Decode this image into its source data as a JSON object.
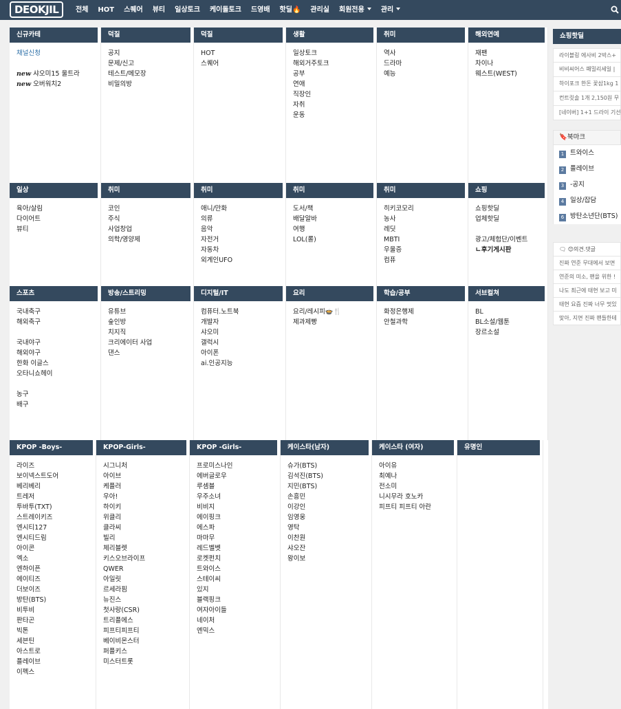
{
  "nav": {
    "logo": "DEOKJIL",
    "items": [
      "전체",
      "HOT",
      "스퀘어",
      "뷰티",
      "일상토크",
      "케이돌토크",
      "드영배",
      "핫딜🔥",
      "관리실",
      "회원전용",
      "관리"
    ],
    "search_icon": "search-icon"
  },
  "rows": [
    [
      {
        "title": "신규카테",
        "links": [
          {
            "text": "채널신청",
            "style": "blue"
          },
          {
            "gap": true
          },
          {
            "text": "샤오미15 울트라",
            "new": "new"
          },
          {
            "text": "오버워치2",
            "new": "new"
          }
        ]
      },
      {
        "title": "덕질",
        "links": [
          {
            "text": "공지"
          },
          {
            "text": "문제/신고"
          },
          {
            "text": "테스트/메모장"
          },
          {
            "text": "비밀의방"
          }
        ]
      },
      {
        "title": "덕질",
        "links": [
          {
            "text": "HOT"
          },
          {
            "text": "스퀘어"
          }
        ]
      },
      {
        "title": "생활",
        "links": [
          {
            "text": "일상토크"
          },
          {
            "text": "해외거주토크"
          },
          {
            "text": "공부"
          },
          {
            "text": "연애"
          },
          {
            "text": "직장인"
          },
          {
            "text": "자취"
          },
          {
            "text": "운동"
          }
        ]
      },
      {
        "title": "취미",
        "links": [
          {
            "text": "역사"
          },
          {
            "text": "드라마"
          },
          {
            "text": "예능"
          }
        ]
      },
      {
        "title": "해외연예",
        "links": [
          {
            "text": "재팬"
          },
          {
            "text": "차이나"
          },
          {
            "text": "웨스트(WEST)"
          }
        ]
      }
    ],
    [
      {
        "title": "일상",
        "links": [
          {
            "text": "육아/살림"
          },
          {
            "text": "다이어트"
          },
          {
            "text": "뷰티"
          }
        ]
      },
      {
        "title": "취미",
        "links": [
          {
            "text": "코인"
          },
          {
            "text": "주식"
          },
          {
            "text": "사업창업"
          },
          {
            "text": "의학/영양제"
          }
        ]
      },
      {
        "title": "취미",
        "links": [
          {
            "text": "애니/만화"
          },
          {
            "text": "의류"
          },
          {
            "text": "음악"
          },
          {
            "text": "자전거"
          },
          {
            "text": "자동차"
          },
          {
            "text": "외계인UFO"
          }
        ]
      },
      {
        "title": "취미",
        "links": [
          {
            "text": "도서/책"
          },
          {
            "text": "배달알바"
          },
          {
            "text": "여행"
          },
          {
            "text": "LOL(롤)"
          }
        ]
      },
      {
        "title": "취미",
        "links": [
          {
            "text": "히키코모리"
          },
          {
            "text": "농사"
          },
          {
            "text": "레딧"
          },
          {
            "text": "MBTI"
          },
          {
            "text": "우울증"
          },
          {
            "text": "컴퓨"
          }
        ]
      },
      {
        "title": "쇼핑",
        "links": [
          {
            "text": "쇼핑핫딜"
          },
          {
            "text": "업체핫딜"
          },
          {
            "gap": true
          },
          {
            "text": "광고/체험단/이벤트"
          },
          {
            "text": "ㄴ후기게시판",
            "style": "bold"
          }
        ]
      }
    ],
    [
      {
        "title": "스포츠",
        "links": [
          {
            "text": "국내축구"
          },
          {
            "text": "해외축구"
          },
          {
            "gap": true
          },
          {
            "text": "국내야구"
          },
          {
            "text": "해외야구"
          },
          {
            "text": "한화 이글스"
          },
          {
            "text": "오타니쇼헤이"
          },
          {
            "gap": true
          },
          {
            "text": "농구"
          },
          {
            "text": "배구"
          }
        ]
      },
      {
        "title": "방송/스트리밍",
        "links": [
          {
            "text": "유튜브"
          },
          {
            "text": "숲인방"
          },
          {
            "text": "치지직"
          },
          {
            "text": "크리에이터 사업"
          },
          {
            "text": "댄스"
          }
        ]
      },
      {
        "title": "디지털/IT",
        "links": [
          {
            "text": "컴퓨터.노트북"
          },
          {
            "text": "개발자"
          },
          {
            "text": "샤오미"
          },
          {
            "text": "갤럭시"
          },
          {
            "text": "아이폰"
          },
          {
            "text": "ai.인공지능"
          }
        ]
      },
      {
        "title": "요리",
        "links": [
          {
            "text": "요리/레시피🍲🍴"
          },
          {
            "text": "제과제빵"
          }
        ]
      },
      {
        "title": "학습/공부",
        "links": [
          {
            "text": "화정은행제"
          },
          {
            "text": "안철과학"
          }
        ]
      },
      {
        "title": "서브컬쳐",
        "links": [
          {
            "text": "BL"
          },
          {
            "text": "BL소설/웹툰"
          },
          {
            "text": "장르소설"
          }
        ]
      }
    ],
    [
      {
        "title": "KPOP -Boys-",
        "links": [
          {
            "text": "라이즈"
          },
          {
            "text": "보이넥스트도어"
          },
          {
            "text": "베리베리"
          },
          {
            "text": "트레저"
          },
          {
            "text": "투바투(TXT)"
          },
          {
            "text": "스트레이키즈"
          },
          {
            "text": "엔시티127"
          },
          {
            "text": "엔시티드림"
          },
          {
            "text": "아이콘"
          },
          {
            "text": "엑소"
          },
          {
            "text": "엔하이픈"
          },
          {
            "text": "에이티즈"
          },
          {
            "text": "더보이즈"
          },
          {
            "text": "방탄(BTS)"
          },
          {
            "text": "비투비"
          },
          {
            "text": "판타곤"
          },
          {
            "text": "빅톤"
          },
          {
            "text": "세븐틴"
          },
          {
            "text": "아스트로"
          },
          {
            "text": "플레이브"
          },
          {
            "text": "이펙스"
          }
        ]
      },
      {
        "title": "KPOP-Girls-",
        "links": [
          {
            "text": "시그니처"
          },
          {
            "text": "아이브"
          },
          {
            "text": "케플러"
          },
          {
            "text": "우아!"
          },
          {
            "text": "하이키"
          },
          {
            "text": "위클리"
          },
          {
            "text": "클라씨"
          },
          {
            "text": "빌리"
          },
          {
            "text": "체리블렛"
          },
          {
            "text": "키스오브라이프"
          },
          {
            "text": "QWER"
          },
          {
            "text": "아일릿"
          },
          {
            "text": "르세라핌"
          },
          {
            "text": "뉴진스"
          },
          {
            "text": "첫사랑(CSR)"
          },
          {
            "text": "트리플에스"
          },
          {
            "text": "피프티피프티"
          },
          {
            "text": "베이비몬스터"
          },
          {
            "text": "퍼플키스"
          },
          {
            "text": "미스터트롯"
          }
        ]
      },
      {
        "title": "KPOP -Girls-",
        "links": [
          {
            "text": "프로미스나인"
          },
          {
            "text": "에버글로우"
          },
          {
            "text": "루셈블"
          },
          {
            "text": "우주소녀"
          },
          {
            "text": "비비지"
          },
          {
            "text": "에이핑크"
          },
          {
            "text": "에스파"
          },
          {
            "text": "마마무"
          },
          {
            "text": "레드벨벳"
          },
          {
            "text": "로켓펀치"
          },
          {
            "text": "트와이스"
          },
          {
            "text": "스테이씨"
          },
          {
            "text": "있지"
          },
          {
            "text": "블랙핑크"
          },
          {
            "text": "여자아이들"
          },
          {
            "text": "네이처"
          },
          {
            "text": "엔믹스"
          }
        ]
      },
      {
        "title": "케이스타(남자)",
        "links": [
          {
            "text": "슈가(BTS)"
          },
          {
            "text": "김석진(BTS)"
          },
          {
            "text": "지민(BTS)"
          },
          {
            "text": "손흥민"
          },
          {
            "text": "이강인"
          },
          {
            "text": "임영웅"
          },
          {
            "text": "영탁"
          },
          {
            "text": "이찬원"
          },
          {
            "text": "샤오잔"
          },
          {
            "text": "왕이보"
          }
        ]
      },
      {
        "title": "케이스타 (여자)",
        "links": [
          {
            "text": "아이유"
          },
          {
            "text": "최예나"
          },
          {
            "text": "전소미"
          },
          {
            "text": "니시무라 호노카"
          },
          {
            "text": "피프티 피프티 아란"
          }
        ]
      },
      {
        "title": "유명인",
        "links": []
      }
    ]
  ],
  "sidebar": {
    "hotdeal_title": "쇼핑핫딜",
    "hotdeals": [
      "라이블링 에사비 2박스+",
      "비비씨어스 패밀리세일 |",
      "하이포크 한돈 꽃삼1kg 1",
      "컨트릿솔 1개 2,150원 무",
      "[네이버] 1+1 드라이 기선"
    ],
    "bookmark_title": "🔖북마크",
    "bookmarks": [
      {
        "num": "1",
        "text": "트와이스"
      },
      {
        "num": "2",
        "text": "플레이브"
      },
      {
        "num": "3",
        "text": "-공지"
      },
      {
        "num": "4",
        "text": "일상/잡담"
      },
      {
        "num": "6",
        "text": "방탄소년단(BTS)"
      }
    ],
    "comment_title": "🗨 😊의견.댓글",
    "comments": [
      "진짜 연준 무대에서 보면",
      "연준의 미소, 팬을 위한 !",
      "나도 최근에 태현 보고 미",
      "태현 요즘 진짜 너무 멋있",
      "맞아, 지면 진짜 팬들한테"
    ]
  }
}
